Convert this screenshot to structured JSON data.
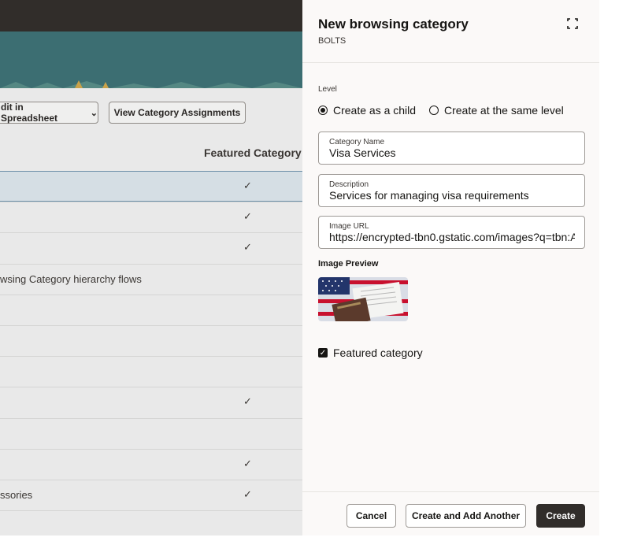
{
  "background": {
    "buttons": {
      "spreadsheet_label": "dit in Spreadsheet",
      "assignments_label": "View Category Assignments"
    },
    "table": {
      "featured_header": "Featured Category",
      "rows": [
        {
          "text": "",
          "featured": true
        },
        {
          "text": "",
          "featured": true
        },
        {
          "text": "",
          "featured": true
        },
        {
          "text": "wsing Category hierarchy flows",
          "featured": false
        },
        {
          "text": "",
          "featured": false
        },
        {
          "text": "",
          "featured": false
        },
        {
          "text": "",
          "featured": false
        },
        {
          "text": "",
          "featured": true
        },
        {
          "text": "",
          "featured": false
        },
        {
          "text": "",
          "featured": true
        },
        {
          "text": "ssories",
          "featured": true
        },
        {
          "text": "",
          "featured": false
        }
      ],
      "check_mark": "✓",
      "chevron": "⌄"
    }
  },
  "drawer": {
    "title": "New browsing category",
    "subtitle": "BOLTS",
    "level_label": "Level",
    "radio_child": "Create as a child",
    "radio_same": "Create at the same level",
    "fields": {
      "name_label": "Category Name",
      "name_value": "Visa Services",
      "description_label": "Description",
      "description_value": "Services for managing visa requirements",
      "image_url_label": "Image URL",
      "image_url_value": "https://encrypted-tbn0.gstatic.com/images?q=tbn:A"
    },
    "image_preview_label": "Image Preview",
    "featured_label": "Featured category",
    "buttons": {
      "cancel": "Cancel",
      "create_another": "Create and Add Another",
      "create": "Create"
    },
    "icons": {
      "expand": "expand-icon"
    }
  },
  "colors": {
    "topbar": "#312d2a",
    "banner": "#3c6e72",
    "primary_button": "#312d2a",
    "selected_row": "#d5dee4"
  }
}
